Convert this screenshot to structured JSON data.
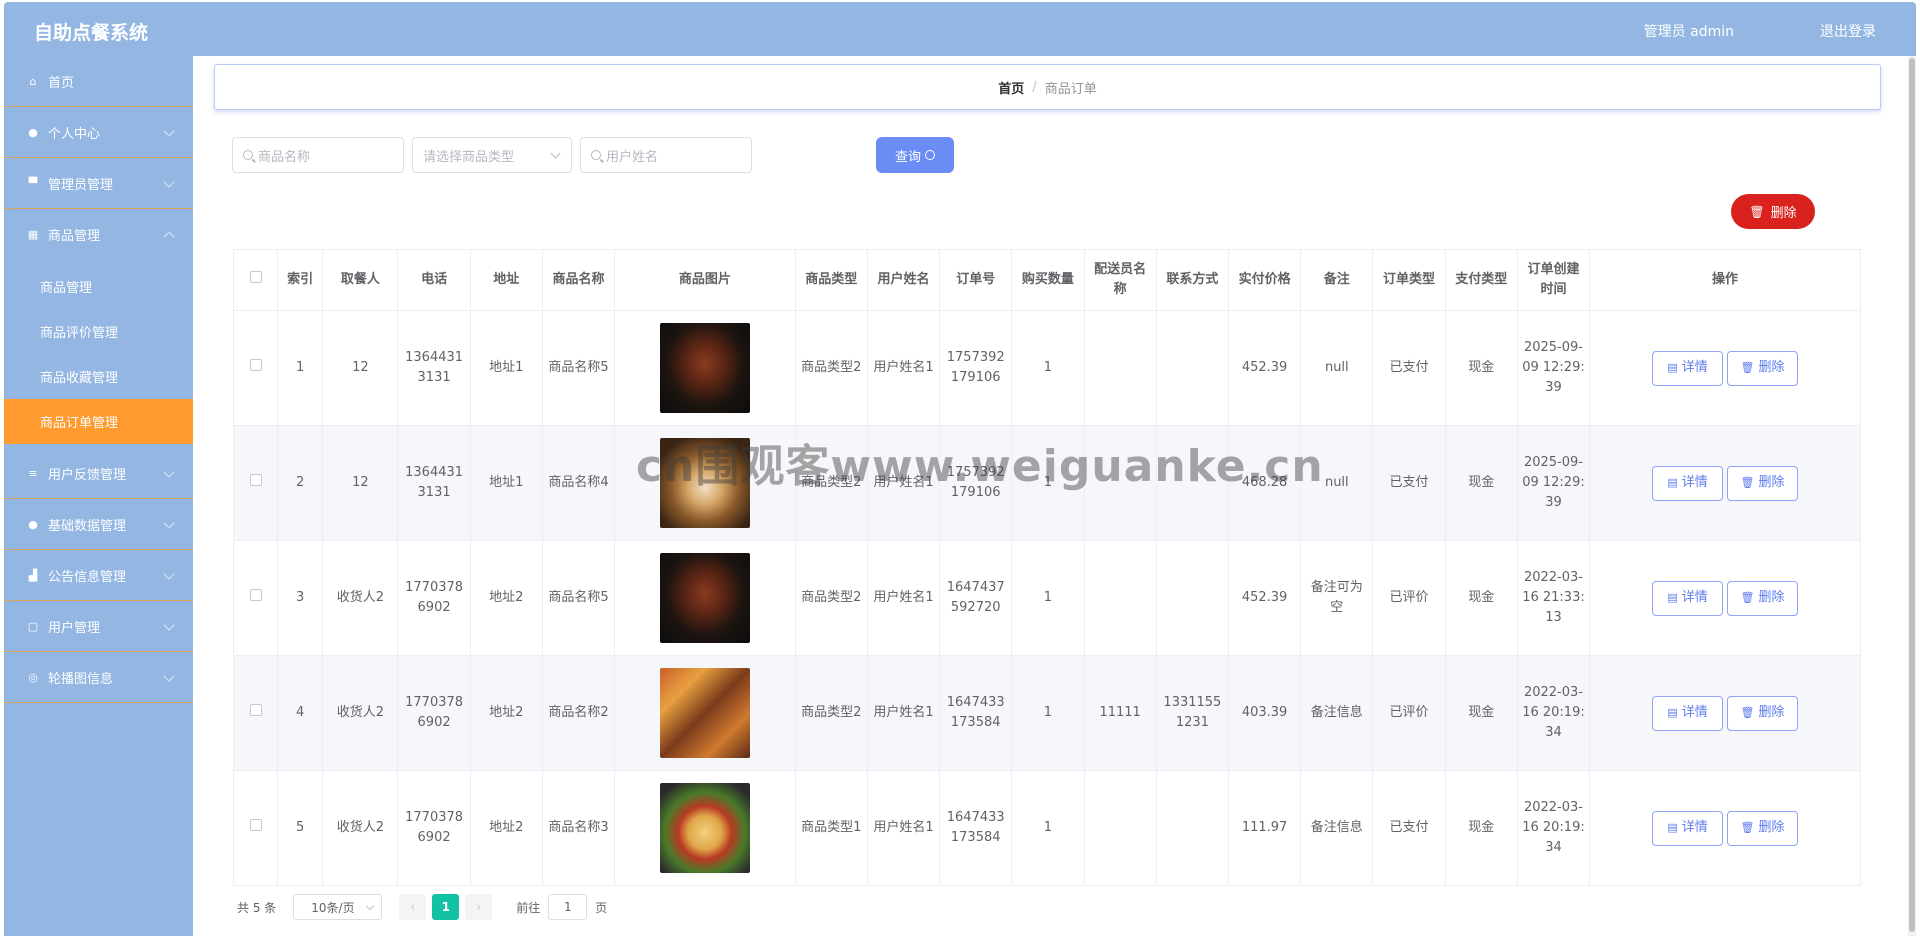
{
  "header": {
    "title": "自助点餐系统",
    "admin_label": "管理员 admin",
    "logout_label": "退出登录"
  },
  "sidebar": {
    "items": [
      {
        "label": "首页",
        "icon": "home-icon",
        "expandable": false
      },
      {
        "label": "个人中心",
        "icon": "user-icon",
        "expandable": true
      },
      {
        "label": "管理员管理",
        "icon": "admin-icon",
        "expandable": true
      },
      {
        "label": "商品管理",
        "icon": "grid-icon",
        "expandable": true,
        "expanded": true,
        "children": [
          "商品管理",
          "商品评价管理",
          "商品收藏管理",
          "商品订单管理"
        ],
        "active_child": 3
      },
      {
        "label": "用户反馈管理",
        "icon": "list-icon",
        "expandable": true
      },
      {
        "label": "基础数据管理",
        "icon": "user-icon",
        "expandable": true
      },
      {
        "label": "公告信息管理",
        "icon": "thumb-icon",
        "expandable": true
      },
      {
        "label": "用户管理",
        "icon": "crop-icon",
        "expandable": true
      },
      {
        "label": "轮播图信息",
        "icon": "compass-icon",
        "expandable": true
      }
    ]
  },
  "breadcrumb": {
    "home": "首页",
    "separator": "/",
    "current": "商品订单"
  },
  "search": {
    "product_name_placeholder": "商品名称",
    "product_type_placeholder": "请选择商品类型",
    "user_name_placeholder": "用户姓名",
    "query_label": "查询"
  },
  "toolbar": {
    "delete_label": "删除"
  },
  "table": {
    "headers": [
      "索引",
      "取餐人",
      "电话",
      "地址",
      "商品名称",
      "商品图片",
      "商品类型",
      "用户姓名",
      "订单号",
      "购买数量",
      "配送员名称",
      "联系方式",
      "实付价格",
      "备注",
      "订单类型",
      "支付类型",
      "订单创建时间",
      "操作"
    ],
    "rows": [
      {
        "index": "1",
        "recipient": "12",
        "phone": "13644313131",
        "address": "地址1",
        "product": "商品名称5",
        "image": "grill",
        "type": "商品类型2",
        "user": "用户姓名1",
        "order_no": "1757392179106",
        "qty": "1",
        "courier": "",
        "contact": "",
        "price": "452.39",
        "note": "null",
        "order_type": "已支付",
        "pay_type": "现金",
        "created": "2025-09-09 12:29:39"
      },
      {
        "index": "2",
        "recipient": "12",
        "phone": "13644313131",
        "address": "地址1",
        "product": "商品名称4",
        "image": "dessert",
        "type": "商品类型2",
        "user": "用户姓名1",
        "order_no": "1757392179106",
        "qty": "1",
        "courier": "",
        "contact": "",
        "price": "468.28",
        "note": "null",
        "order_type": "已支付",
        "pay_type": "现金",
        "created": "2025-09-09 12:29:39"
      },
      {
        "index": "3",
        "recipient": "收货人2",
        "phone": "17703786902",
        "address": "地址2",
        "product": "商品名称5",
        "image": "grill",
        "type": "商品类型2",
        "user": "用户姓名1",
        "order_no": "1647437592720",
        "qty": "1",
        "courier": "",
        "contact": "",
        "price": "452.39",
        "note": "备注可为空",
        "order_type": "已评价",
        "pay_type": "现金",
        "created": "2022-03-16 21:33:13"
      },
      {
        "index": "4",
        "recipient": "收货人2",
        "phone": "17703786902",
        "address": "地址2",
        "product": "商品名称2",
        "image": "skewers",
        "type": "商品类型2",
        "user": "用户姓名1",
        "order_no": "1647433173584",
        "qty": "1",
        "courier": "11111",
        "contact": "13311551231",
        "price": "403.39",
        "note": "备注信息",
        "order_type": "已评价",
        "pay_type": "现金",
        "created": "2022-03-16 20:19:34"
      },
      {
        "index": "5",
        "recipient": "收货人2",
        "phone": "17703786902",
        "address": "地址2",
        "product": "商品名称3",
        "image": "pasta",
        "type": "商品类型1",
        "user": "用户姓名1",
        "order_no": "1647433173584",
        "qty": "1",
        "courier": "",
        "contact": "",
        "price": "111.97",
        "note": "备注信息",
        "order_type": "已支付",
        "pay_type": "现金",
        "created": "2022-03-16 20:19:34"
      }
    ],
    "row_actions": {
      "detail": "详情",
      "delete": "删除"
    }
  },
  "pagination": {
    "total_label": "共 5 条",
    "page_size": "10条/页",
    "current_page": "1",
    "goto_label": "前往",
    "goto_value": "1",
    "page_suffix": "页"
  },
  "watermark": "cn围观客www.weiguanke.cn",
  "colors": {
    "header_bg": "#93b6e3",
    "active_menu": "#ff9a2e",
    "primary": "#6b8cf5",
    "danger": "#d9211e",
    "page_active": "#13c2a3"
  }
}
